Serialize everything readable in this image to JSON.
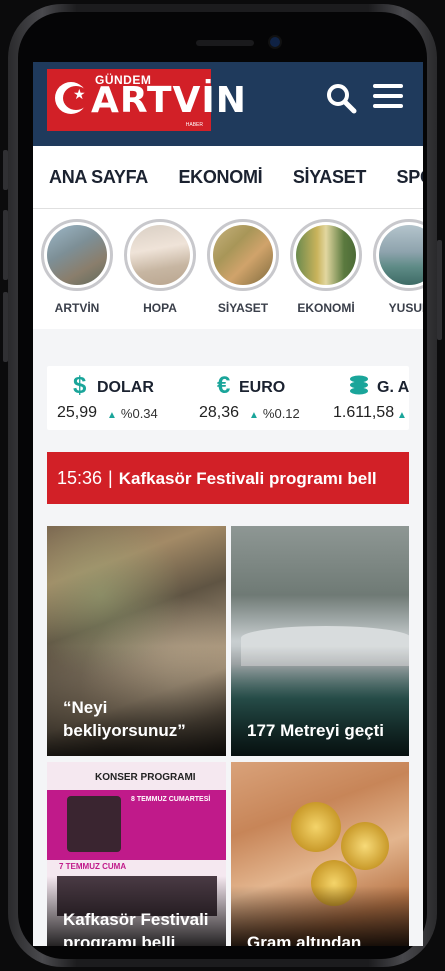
{
  "header": {
    "logo_top": "GÜNDEM",
    "logo_main": "ARTVİN",
    "logo_sub": "HABER"
  },
  "nav": {
    "items": [
      "ANA SAYFA",
      "EKONOMİ",
      "SİYASET",
      "SPOR"
    ]
  },
  "stories": {
    "items": [
      {
        "label": "ARTVİN"
      },
      {
        "label": "HOPA"
      },
      {
        "label": "SİYASET"
      },
      {
        "label": "EKONOMİ"
      },
      {
        "label": "YUSUF"
      }
    ]
  },
  "currency": {
    "items": [
      {
        "name": "DOLAR",
        "icon": "dollar-icon",
        "symbol": "$",
        "value": "25,99",
        "change": "%0.34",
        "color": "#1aa59a"
      },
      {
        "name": "EURO",
        "icon": "euro-icon",
        "symbol": "€",
        "value": "28,36",
        "change": "%0.12",
        "color": "#1aa59a"
      },
      {
        "name": "G. A",
        "icon": "gold-coins-icon",
        "symbol": "≋",
        "value": "1.611,58",
        "change": "",
        "color": "#1aa59a"
      }
    ]
  },
  "ticker": {
    "time": "15:36",
    "separator": "|",
    "text": "Kafkasör Festivali programı bell"
  },
  "news": {
    "cards": [
      {
        "caption": "“Neyi bekliyorsunuz”"
      },
      {
        "caption": "177 Metreyi geçti"
      },
      {
        "caption": "Kafkasör Festivali programı belli"
      },
      {
        "caption": "Gram altından"
      }
    ],
    "poster": {
      "title": "KONSER PROGRAMI",
      "day1": "8 TEMMUZ CUMARTESİ",
      "day2": "7 TEMMUZ CUMA"
    }
  },
  "colors": {
    "brand_red": "#d22027",
    "header_navy": "#1f3a5c",
    "accent_teal": "#1aa59a"
  }
}
